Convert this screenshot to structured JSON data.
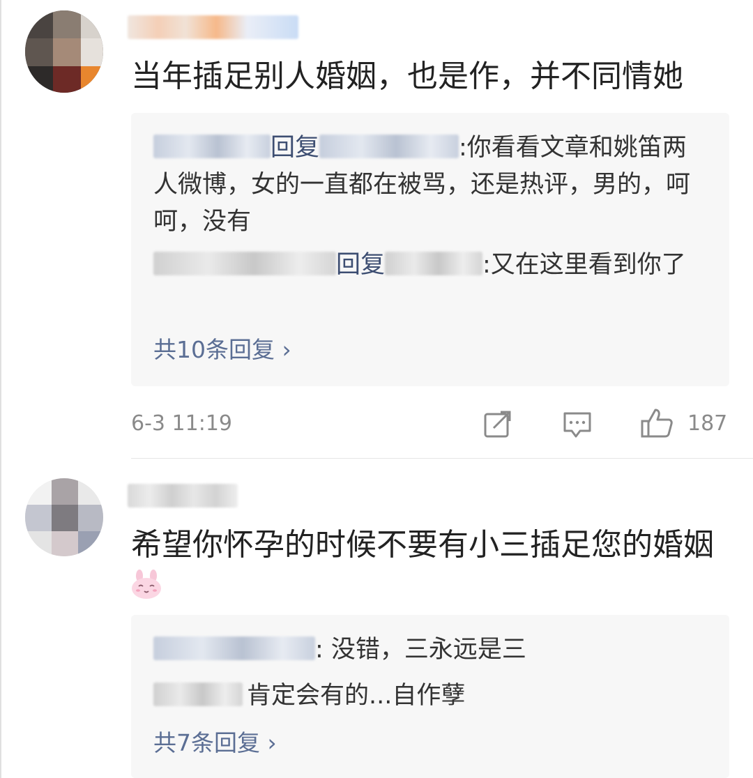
{
  "comments": [
    {
      "text": "当年插足别人婚姻，也是作，并不同情她",
      "replies": [
        {
          "verb": "回复",
          "text": ":你看看文章和姚笛两人微博，女的一直都在被骂，还是热评，男的，呵呵，没有"
        },
        {
          "verb": "回复",
          "text": ":又在这里看到你了"
        }
      ],
      "more_label": "共10条回复 ›",
      "time": "6-3 11:19",
      "like_count": "187"
    },
    {
      "text": "希望你怀孕的时候不要有小三插足您的婚姻",
      "emoji": "rabbit-emoji",
      "replies": [
        {
          "text": ": 没错，三永远是三"
        },
        {
          "text": "肯定会有的...自作孽"
        }
      ],
      "more_label": "共7条回复 ›"
    }
  ],
  "icons": {
    "repost": "repost-icon",
    "comment": "comment-icon",
    "like": "thumbs-up-icon"
  }
}
